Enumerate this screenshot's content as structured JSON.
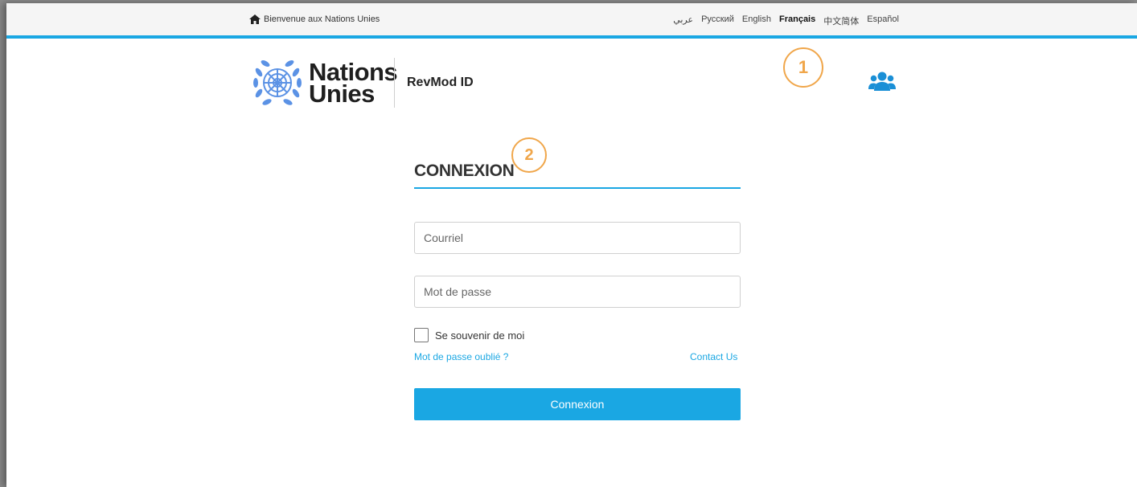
{
  "topbar": {
    "welcome_text": "Bienvenue aux Nations Unies",
    "welcome_icon": "home-icon",
    "languages": [
      "عربي",
      "Русский",
      "English",
      "Français",
      "中文简体",
      "Español"
    ],
    "active_language": "Français"
  },
  "header": {
    "logo_line1": "Nations",
    "logo_line2": "Unies",
    "app_title": "RevMod ID",
    "user_icon": "users-icon"
  },
  "callouts": [
    "1",
    "2"
  ],
  "login": {
    "title": "CONNEXION",
    "email_placeholder": "Courriel",
    "password_placeholder": "Mot de passe",
    "remember_label": "Se souvenir de moi",
    "forgot_link": "Mot de passe oublié ?",
    "contact_link": "Contact Us",
    "submit_label": "Connexion"
  },
  "colors": {
    "accent": "#1aa7e3",
    "callout": "#f0a64a",
    "un_blue": "#5b92e5"
  }
}
